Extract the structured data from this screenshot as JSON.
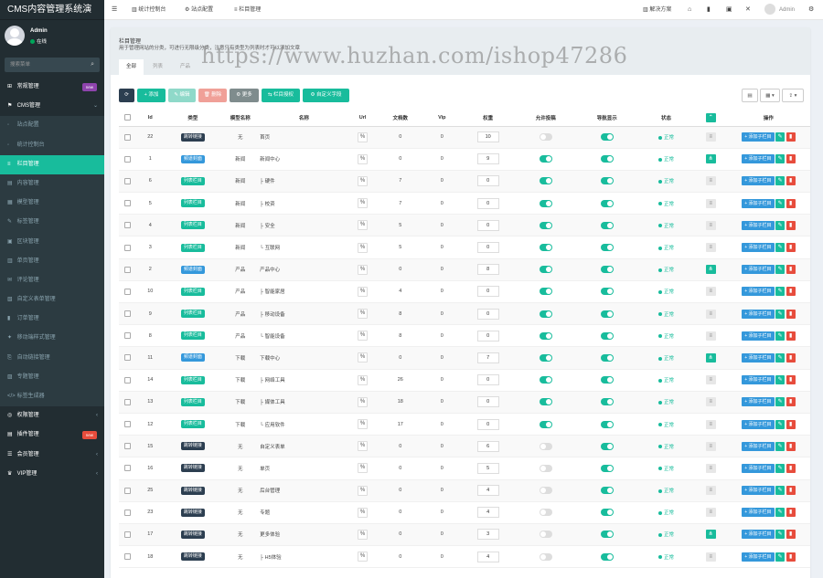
{
  "app": {
    "title": "CMS内容管理系统演",
    "user": "Admin",
    "status": "在线"
  },
  "sidebar": {
    "search_placeholder": "搜索菜单",
    "items": [
      {
        "icon": "⊞",
        "label": "常规管理",
        "badge": "new",
        "badge_color": "#8e44ad",
        "type": "top"
      },
      {
        "icon": "⚑",
        "label": "CMS管理",
        "arrow": "⌄",
        "type": "top"
      },
      {
        "icon": "◦",
        "label": "站点配置",
        "type": "sub"
      },
      {
        "icon": "◦",
        "label": "统计控制台",
        "type": "sub"
      },
      {
        "icon": "≡",
        "label": "栏目管理",
        "type": "active"
      },
      {
        "icon": "▤",
        "label": "内容管理",
        "type": "sub"
      },
      {
        "icon": "▦",
        "label": "模型管理",
        "type": "sub"
      },
      {
        "icon": "✎",
        "label": "标签管理",
        "type": "sub"
      },
      {
        "icon": "▣",
        "label": "区块管理",
        "type": "sub"
      },
      {
        "icon": "▥",
        "label": "单页管理",
        "type": "sub"
      },
      {
        "icon": "✉",
        "label": "评论管理",
        "type": "sub"
      },
      {
        "icon": "▧",
        "label": "自定义表单管理",
        "type": "sub"
      },
      {
        "icon": "▮",
        "label": "订单管理",
        "type": "sub"
      },
      {
        "icon": "✦",
        "label": "移动端样式管理",
        "type": "sub"
      },
      {
        "icon": "⎘",
        "label": "自动链接管理",
        "type": "sub"
      },
      {
        "icon": "▨",
        "label": "专题管理",
        "type": "sub"
      },
      {
        "icon": "</>",
        "label": "标签生成器",
        "type": "sub"
      },
      {
        "icon": "◎",
        "label": "权限管理",
        "arrow": "‹",
        "type": "top"
      },
      {
        "icon": "▤",
        "label": "插件管理",
        "badge": "new",
        "badge_color": "#e74c3c",
        "type": "top"
      },
      {
        "icon": "☰",
        "label": "会员管理",
        "arrow": "‹",
        "type": "top"
      },
      {
        "icon": "♛",
        "label": "VIP管理",
        "arrow": "‹",
        "type": "top"
      }
    ]
  },
  "topbar": {
    "tabs": [
      {
        "icon": "▥",
        "label": "统计控制台"
      },
      {
        "icon": "⚙",
        "label": "站点配置"
      },
      {
        "icon": "≡",
        "label": "栏目管理"
      }
    ],
    "right": {
      "solution": "解决方案",
      "user": "Admin"
    }
  },
  "panel": {
    "title": "栏目管理",
    "desc": "用于管理网站的分类，可进行无限级分类，注意只有类型为列表时才可以添加文章",
    "tabs": [
      "全部",
      "列表",
      "产品"
    ],
    "watermark": "https://www.huzhan.com/ishop47286"
  },
  "toolbar": {
    "refresh": "⟳",
    "add": "+ 添加",
    "edit": "✎ 编辑",
    "del": "🗑 删除",
    "more": "⚙ 更多",
    "auth": "⇆ 栏目授权",
    "custom": "⚙ 自定义字段"
  },
  "table": {
    "headers": [
      "",
      "Id",
      "类型",
      "模型名称",
      "名称",
      "Url",
      "文档数",
      "Vip",
      "权重",
      "允许投稿",
      "导航显示",
      "状态",
      "",
      "操作"
    ],
    "add_sub": "添加子栏目",
    "status_text": "正常",
    "rows": [
      {
        "id": "22",
        "type": "跳转链接",
        "tc": "dark",
        "model": "无",
        "name": "首页",
        "docs": "0",
        "vip": "0",
        "weight": "10",
        "allow": false,
        "nav": true,
        "child": false
      },
      {
        "id": "1",
        "type": "频道封面",
        "tc": "blue",
        "model": "新闻",
        "name": "新闻中心",
        "docs": "0",
        "vip": "0",
        "weight": "9",
        "allow": true,
        "nav": true,
        "child": true
      },
      {
        "id": "6",
        "type": "列表栏目",
        "tc": "green",
        "model": "新闻",
        "name": "├ 硬件",
        "docs": "7",
        "vip": "0",
        "weight": "0",
        "allow": true,
        "nav": true,
        "child": false
      },
      {
        "id": "5",
        "type": "列表栏目",
        "tc": "green",
        "model": "新闻",
        "name": "├ 校资",
        "docs": "7",
        "vip": "0",
        "weight": "0",
        "allow": true,
        "nav": true,
        "child": false
      },
      {
        "id": "4",
        "type": "列表栏目",
        "tc": "green",
        "model": "新闻",
        "name": "├ 安全",
        "docs": "5",
        "vip": "0",
        "weight": "0",
        "allow": true,
        "nav": true,
        "child": false
      },
      {
        "id": "3",
        "type": "列表栏目",
        "tc": "green",
        "model": "新闻",
        "name": "└ 互联网",
        "docs": "5",
        "vip": "0",
        "weight": "0",
        "allow": true,
        "nav": true,
        "child": false
      },
      {
        "id": "2",
        "type": "频道封面",
        "tc": "blue",
        "model": "产品",
        "name": "产品中心",
        "docs": "0",
        "vip": "0",
        "weight": "8",
        "allow": true,
        "nav": true,
        "child": true
      },
      {
        "id": "10",
        "type": "列表栏目",
        "tc": "green",
        "model": "产品",
        "name": "├ 智能家居",
        "docs": "4",
        "vip": "0",
        "weight": "0",
        "allow": true,
        "nav": true,
        "child": false
      },
      {
        "id": "9",
        "type": "列表栏目",
        "tc": "green",
        "model": "产品",
        "name": "├ 移动设备",
        "docs": "8",
        "vip": "0",
        "weight": "0",
        "allow": true,
        "nav": true,
        "child": false
      },
      {
        "id": "8",
        "type": "列表栏目",
        "tc": "green",
        "model": "产品",
        "name": "└ 智能设备",
        "docs": "8",
        "vip": "0",
        "weight": "0",
        "allow": true,
        "nav": true,
        "child": false
      },
      {
        "id": "11",
        "type": "频道封面",
        "tc": "blue",
        "model": "下载",
        "name": "下载中心",
        "docs": "0",
        "vip": "0",
        "weight": "7",
        "allow": true,
        "nav": true,
        "child": true
      },
      {
        "id": "14",
        "type": "列表栏目",
        "tc": "green",
        "model": "下载",
        "name": "├ 网络工具",
        "docs": "26",
        "vip": "0",
        "weight": "0",
        "allow": true,
        "nav": true,
        "child": false
      },
      {
        "id": "13",
        "type": "列表栏目",
        "tc": "green",
        "model": "下载",
        "name": "├ 媒体工具",
        "docs": "18",
        "vip": "0",
        "weight": "0",
        "allow": true,
        "nav": true,
        "child": false
      },
      {
        "id": "12",
        "type": "列表栏目",
        "tc": "green",
        "model": "下载",
        "name": "└ 应用软件",
        "docs": "17",
        "vip": "0",
        "weight": "0",
        "allow": true,
        "nav": true,
        "child": false
      },
      {
        "id": "15",
        "type": "跳转链接",
        "tc": "dark",
        "model": "无",
        "name": "自定义表单",
        "docs": "0",
        "vip": "0",
        "weight": "6",
        "allow": false,
        "nav": true,
        "child": false
      },
      {
        "id": "16",
        "type": "跳转链接",
        "tc": "dark",
        "model": "无",
        "name": "单页",
        "docs": "0",
        "vip": "0",
        "weight": "5",
        "allow": false,
        "nav": true,
        "child": false
      },
      {
        "id": "25",
        "type": "跳转链接",
        "tc": "dark",
        "model": "无",
        "name": "后台管理",
        "docs": "0",
        "vip": "0",
        "weight": "4",
        "allow": false,
        "nav": true,
        "child": false
      },
      {
        "id": "23",
        "type": "跳转链接",
        "tc": "dark",
        "model": "无",
        "name": "专题",
        "docs": "0",
        "vip": "0",
        "weight": "4",
        "allow": false,
        "nav": true,
        "child": false
      },
      {
        "id": "17",
        "type": "跳转链接",
        "tc": "dark",
        "model": "无",
        "name": "更多体验",
        "docs": "0",
        "vip": "0",
        "weight": "3",
        "allow": false,
        "nav": true,
        "child": true
      },
      {
        "id": "18",
        "type": "跳转链接",
        "tc": "dark",
        "model": "无",
        "name": "├ H5体验",
        "docs": "0",
        "vip": "0",
        "weight": "4",
        "allow": false,
        "nav": true,
        "child": false
      }
    ]
  }
}
